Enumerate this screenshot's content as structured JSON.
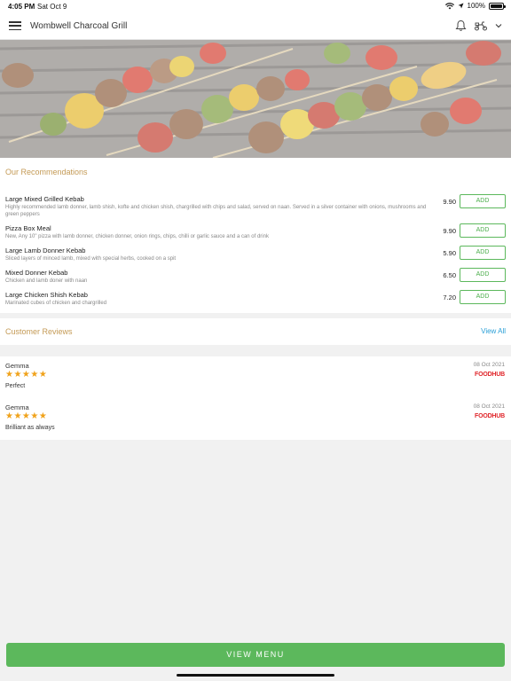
{
  "status_bar": {
    "time": "4:05 PM",
    "date": "Sat Oct 9",
    "battery": "100%"
  },
  "header": {
    "title": "Wombwell Charcoal Grill"
  },
  "recommendations": {
    "title": "Our Recommendations",
    "add_label": "ADD",
    "items": [
      {
        "name": "Large Mixed Grilled Kebab",
        "description": "Highly recommended lamb donner, lamb shish, kofte and chicken shish, chargrilled with chips and salad, served on naan. Served in a silver container with onions, mushrooms and green peppers",
        "price": "9.90"
      },
      {
        "name": "Pizza Box Meal",
        "description": "New, Any 10\" pizza with lamb donner, chicken donner, onion rings, chips, chilli or garlic sauce and a can of drink",
        "price": "9.90"
      },
      {
        "name": "Large Lamb Donner Kebab",
        "description": "Sliced layers of minced lamb, mixed with special herbs, cooked on a spit",
        "price": "5.90"
      },
      {
        "name": "Mixed Donner Kebab",
        "description": "Chicken and lamb doner with naan",
        "price": "6.50"
      },
      {
        "name": "Large Chicken Shish Kebab",
        "description": "Marinated cubes of chicken and chargrilled",
        "price": "7.20"
      }
    ]
  },
  "reviews": {
    "title": "Customer Reviews",
    "view_all": "View All",
    "items": [
      {
        "author": "Gemma",
        "date": "08 Oct 2021",
        "stars": "★★★★★",
        "rating": 5,
        "source": "FOODHUB",
        "comment": "Perfect"
      },
      {
        "author": "Gemma",
        "date": "08 Oct 2021",
        "stars": "★★★★★",
        "rating": 5,
        "source": "FOODHUB",
        "comment": "Brilliant as always"
      }
    ]
  },
  "footer": {
    "view_menu": "VIEW MENU"
  },
  "colors": {
    "accent_green": "#5cb85c",
    "section_title": "#c49a55",
    "link_blue": "#2a9fd6",
    "star": "#f0a21a",
    "foodhub_red": "#e0262b"
  }
}
